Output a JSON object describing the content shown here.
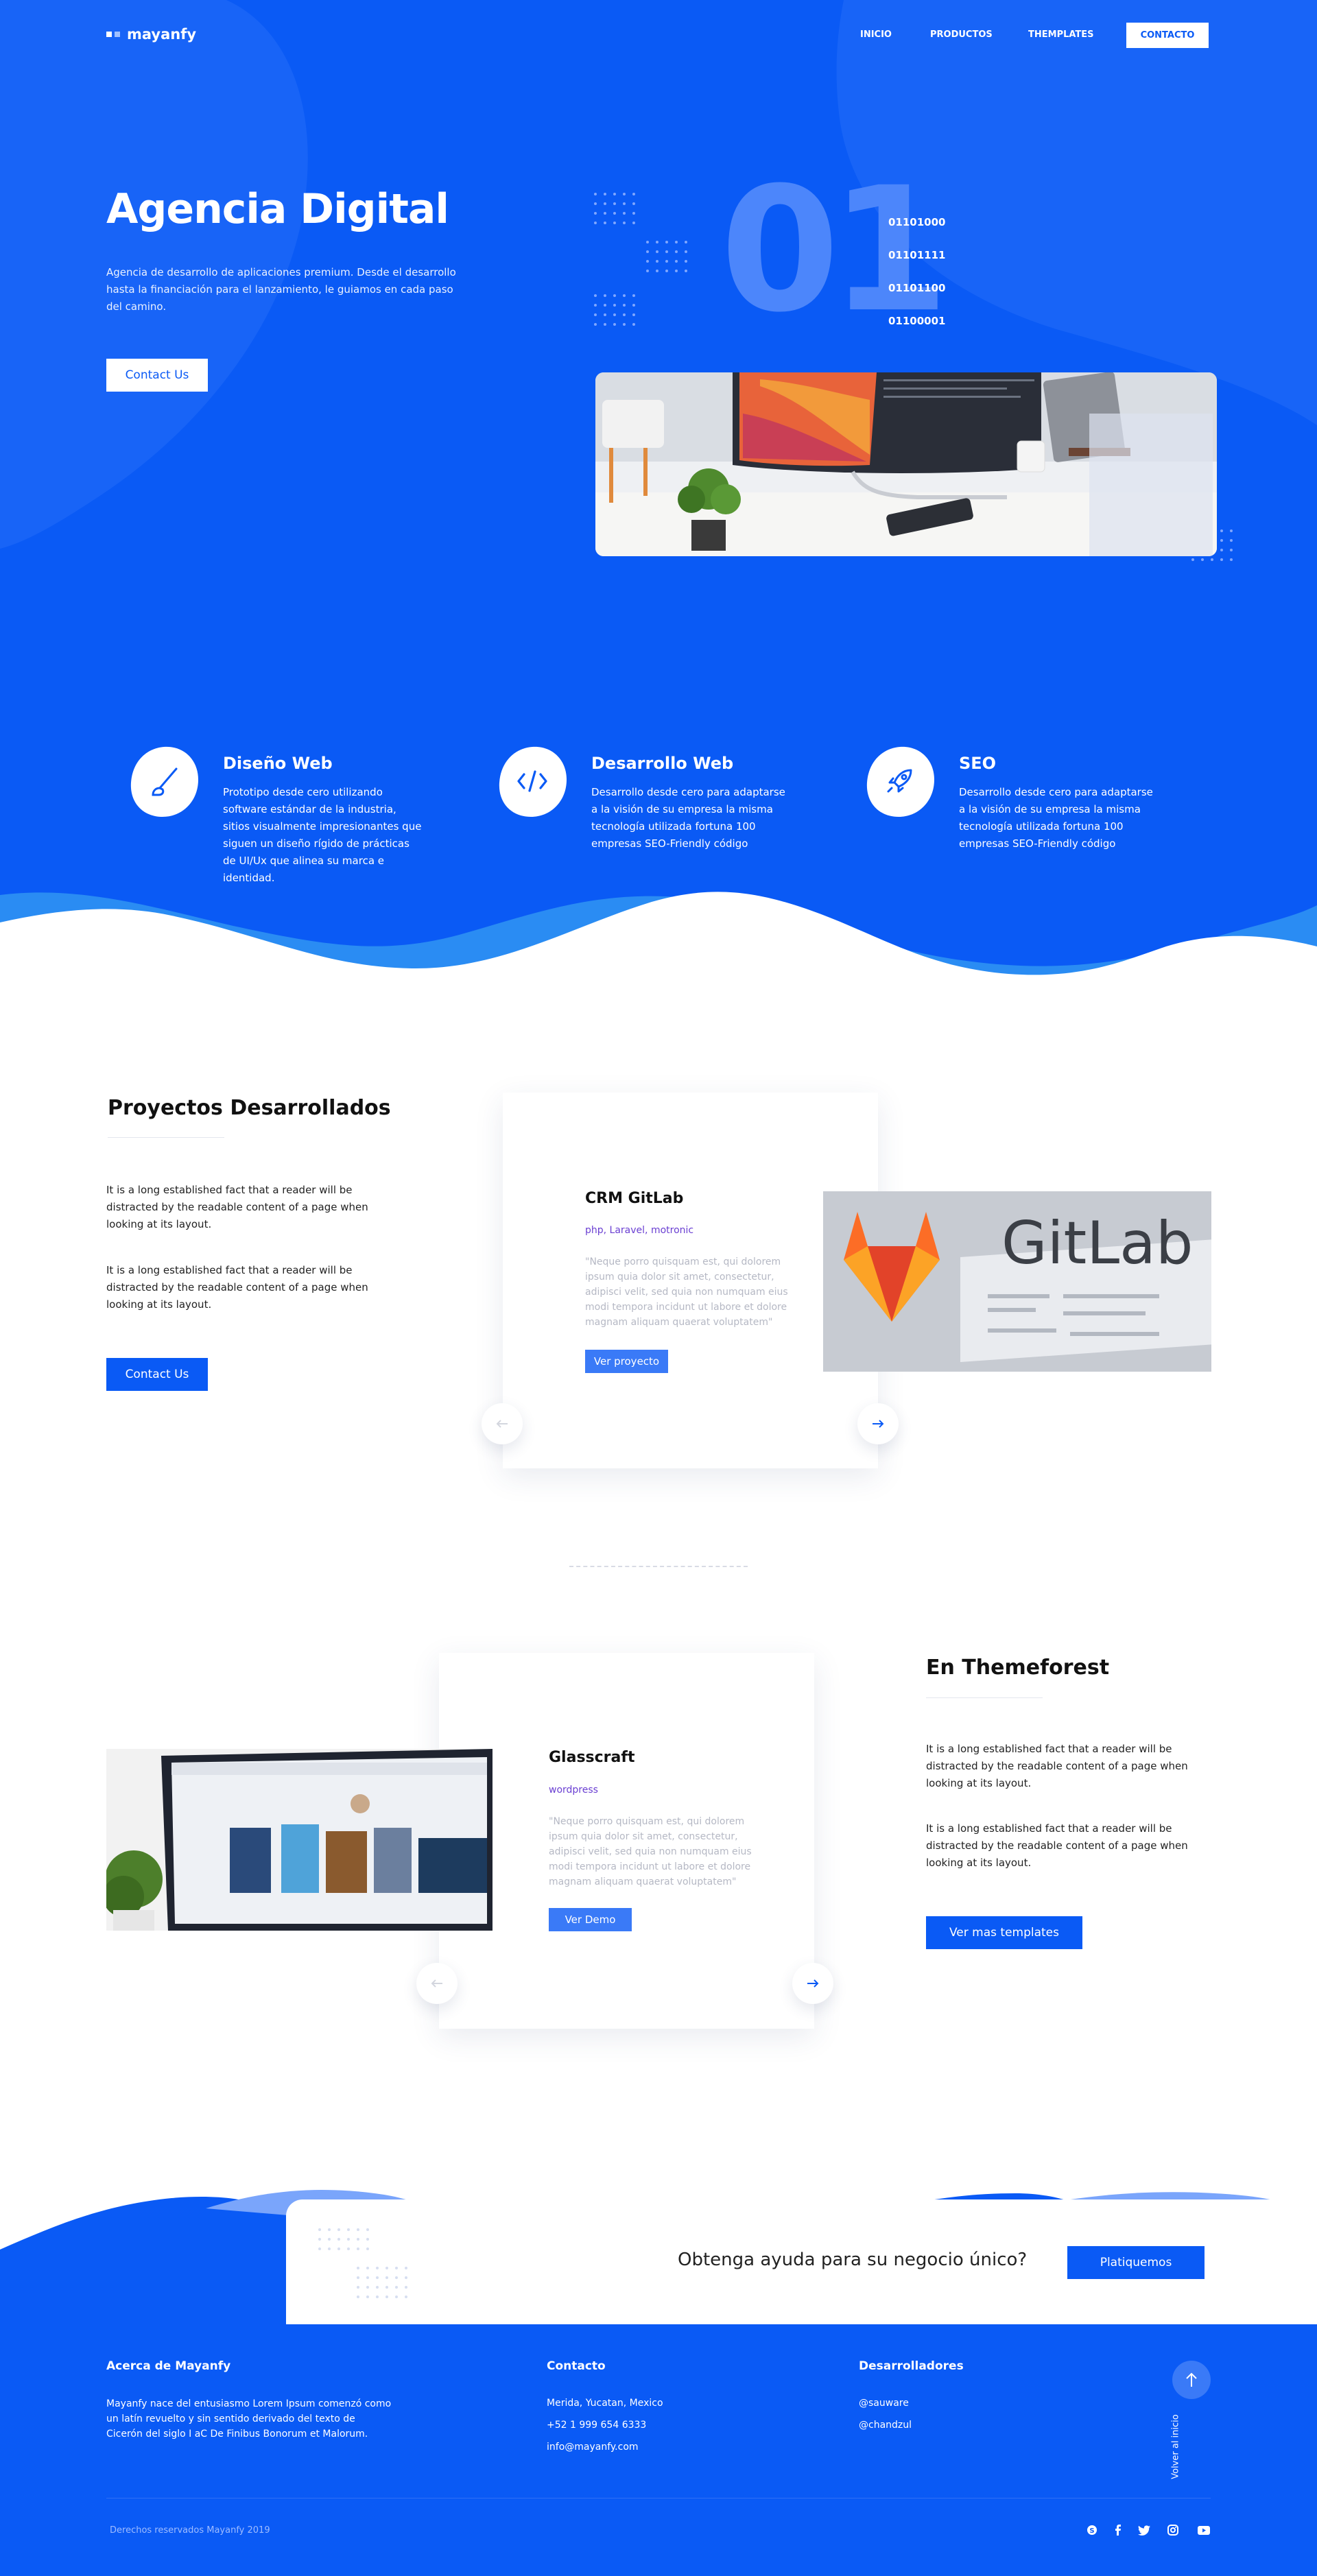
{
  "colors": {
    "brand": "#0a5af5",
    "light_blue": "#4c86fb",
    "accent_purple": "#6a3fd2",
    "white": "#ffffff"
  },
  "header": {
    "logo": "mayanfy",
    "nav": [
      "INICIO",
      "PRODUCTOS",
      "THEMPLATES",
      "CONTACTO"
    ]
  },
  "hero": {
    "title": "Agencia Digital",
    "description": "Agencia de desarrollo de aplicaciones premium. Desde el desarrollo hasta la financiación para el lanzamiento, le guiamos en cada paso del camino.",
    "cta": "Contact Us",
    "big_number": "01",
    "binary": [
      "01101000",
      "01101111",
      "01101100",
      "01100001"
    ]
  },
  "services": [
    {
      "icon": "paintbrush-icon",
      "title": "Diseño Web",
      "text": "Prototipo desde cero utilizando software estándar de la industria, sitios visualmente impresionantes que siguen un diseño rígido de prácticas de UI/Ux que alinea su marca e identidad."
    },
    {
      "icon": "code-icon",
      "title": "Desarrollo Web",
      "text": "Desarrollo desde cero para adaptarse a la visión de su empresa la misma tecnología utilizada fortuna 100 empresas SEO-Friendly código"
    },
    {
      "icon": "rocket-icon",
      "title": "SEO",
      "text": "Desarrollo desde cero para adaptarse a la visión de su empresa la misma tecnología utilizada fortuna 100 empresas SEO-Friendly código"
    }
  ],
  "projects": {
    "title": "Proyectos Desarrollados",
    "paragraphs": [
      "It is a long established fact that a reader will be distracted by the readable content of a page when looking at its layout.",
      "It is a long established fact that a reader will be distracted by the readable content of a page when looking at its layout."
    ],
    "cta": "Contact Us",
    "card": {
      "title": "CRM GitLab",
      "tags": "php, Laravel, motronic",
      "lorem": "\"Neque porro quisquam est, qui dolorem ipsum quia dolor sit amet, consectetur, adipisci velit, sed quia non numquam eius modi tempora incidunt ut labore et dolore magnam aliquam quaerat voluptatem\"",
      "button": "Ver proyecto",
      "image_text": "GitLab"
    }
  },
  "themeforest": {
    "title": "En Themeforest",
    "paragraphs": [
      "It is a long established fact that a reader will be distracted by the readable content of a page when looking at its layout.",
      "It is a long established fact that a reader will be distracted by the readable content of a page when looking at its layout."
    ],
    "cta": "Ver mas templates",
    "card": {
      "title": "Glasscraft",
      "tags": "wordpress",
      "lorem": "\"Neque porro quisquam est, qui dolorem ipsum quia dolor sit amet, consectetur, adipisci velit, sed quia non numquam eius modi tempora incidunt ut labore et dolore magnam aliquam quaerat voluptatem\"",
      "button": "Ver Demo"
    }
  },
  "cta_band": {
    "text": "Obtenga ayuda para su negocio único?",
    "button": "Platiquemos"
  },
  "footer": {
    "about_title": "Acerca de Mayanfy",
    "about_text": "Mayanfy nace del entusiasmo Lorem Ipsum comenzó como un latín revuelto y sin sentido derivado del texto de Cicerón del siglo I aC De Finibus Bonorum et Malorum.",
    "contact_title": "Contacto",
    "contact": [
      "Merida, Yucatan, Mexico",
      "+52 1 999 654 6333",
      "info@mayanfy.com"
    ],
    "dev_title": "Desarrolladores",
    "devs": [
      "@sauware",
      "@chandzul"
    ],
    "back_to_top": "Volver al inicio",
    "copyright": "Derechos reservados Mayanfy 2019",
    "social": [
      "skype-icon",
      "facebook-icon",
      "twitter-icon",
      "instagram-icon",
      "youtube-icon"
    ]
  }
}
